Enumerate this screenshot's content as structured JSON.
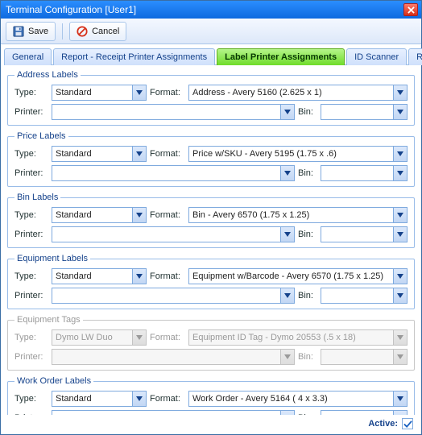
{
  "window": {
    "title": "Terminal Configuration [User1]"
  },
  "toolbar": {
    "save": "Save",
    "cancel": "Cancel"
  },
  "tabs": [
    {
      "label": "General"
    },
    {
      "label": "Report - Receipt Printer Assignments"
    },
    {
      "label": "Label Printer Assignments",
      "active": true
    },
    {
      "label": "ID Scanner"
    },
    {
      "label": "RDM"
    }
  ],
  "labels": {
    "type": "Type:",
    "format": "Format:",
    "printer": "Printer:",
    "bin": "Bin:"
  },
  "groups": [
    {
      "legend": "Address Labels",
      "type": "Standard",
      "format": "Address - Avery 5160 (2.625 x 1)",
      "printer": "",
      "bin": "",
      "disabled": false
    },
    {
      "legend": "Price Labels",
      "type": "Standard",
      "format": "Price w/SKU - Avery 5195 (1.75 x .6)",
      "printer": "",
      "bin": "",
      "disabled": false
    },
    {
      "legend": "Bin Labels",
      "type": "Standard",
      "format": "Bin - Avery 6570 (1.75 x 1.25)",
      "printer": "",
      "bin": "",
      "disabled": false
    },
    {
      "legend": "Equipment Labels",
      "type": "Standard",
      "format": "Equipment w/Barcode - Avery 6570 (1.75 x 1.25)",
      "printer": "",
      "bin": "",
      "disabled": false
    },
    {
      "legend": "Equipment Tags",
      "type": "Dymo LW Duo",
      "format": "Equipment ID Tag - Dymo 20553 (.5 x 18)",
      "printer": "",
      "bin": "",
      "disabled": true
    },
    {
      "legend": "Work Order Labels",
      "type": "Standard",
      "format": "Work Order - Avery 5164 ( 4 x 3.3)",
      "printer": "",
      "bin": "",
      "disabled": false
    }
  ],
  "footer": {
    "active_label": "Active:",
    "active_checked": true
  }
}
